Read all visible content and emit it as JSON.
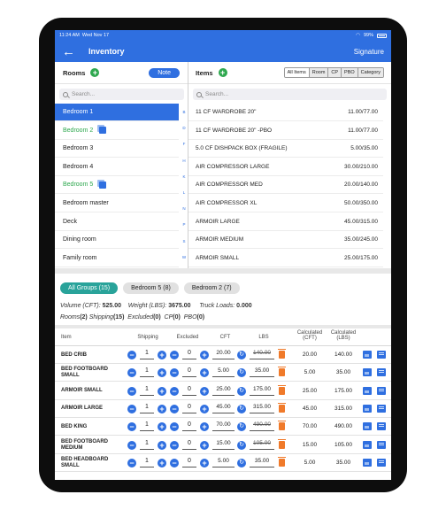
{
  "status": {
    "time": "11:24 AM",
    "date": "Wed Nov 17",
    "battery": "99%"
  },
  "nav": {
    "back_icon": "back-arrow-icon",
    "title": "Inventory",
    "signature": "Signature"
  },
  "rooms": {
    "header": "Rooms",
    "note_label": "Note",
    "search_placeholder": "Search...",
    "items": [
      {
        "label": "Bedroom 1",
        "state": "selected",
        "copy": false
      },
      {
        "label": "Bedroom 2",
        "state": "has-items",
        "copy": true
      },
      {
        "label": "Bedroom 3",
        "state": "normal",
        "copy": false
      },
      {
        "label": "Bedroom 4",
        "state": "normal",
        "copy": false
      },
      {
        "label": "Bedroom 5",
        "state": "has-items",
        "copy": true
      },
      {
        "label": "Bedroom master",
        "state": "normal",
        "copy": false
      },
      {
        "label": "Deck",
        "state": "normal",
        "copy": false
      },
      {
        "label": "Dining room",
        "state": "normal",
        "copy": false
      },
      {
        "label": "Family room",
        "state": "normal",
        "copy": false
      }
    ],
    "index_letters": [
      "B",
      "D",
      "F",
      "H",
      "K",
      "L",
      "N",
      "P",
      "S",
      "W"
    ]
  },
  "items": {
    "header": "Items",
    "search_placeholder": "Search...",
    "filters": [
      "All Items",
      "Room",
      "CP",
      "PBO",
      "Category"
    ],
    "list": [
      {
        "label": "11 CF WARDROBE 20\"",
        "value": "11.00/77.00"
      },
      {
        "label": "11 CF WARDROBE 20\" -PBO",
        "value": "11.00/77.00"
      },
      {
        "label": "5.0 CF DISHPACK BOX (FRAGILE)",
        "value": "5.00/35.00"
      },
      {
        "label": "AIR COMPRESSOR LARGE",
        "value": "30.00/210.00"
      },
      {
        "label": "AIR COMPRESSOR MED",
        "value": "20.00/140.00"
      },
      {
        "label": "AIR COMPRESSOR XL",
        "value": "50.00/350.00"
      },
      {
        "label": "ARMOIR LARGE",
        "value": "45.00/315.00"
      },
      {
        "label": "ARMOIR MEDIUM",
        "value": "35.00/245.00"
      },
      {
        "label": "ARMOIR SMALL",
        "value": "25.00/175.00"
      }
    ]
  },
  "groups": {
    "chips": [
      "All Groups (15)",
      "Bedroom 5 (8)",
      "Bedroom 2 (7)"
    ]
  },
  "summary": {
    "volume_label": "Volume (CFT):",
    "volume_value": "525.00",
    "weight_label": "Weight (LBS):",
    "weight_value": "3675.00",
    "truck_label": "Truck Loads:",
    "truck_value": "0.000",
    "rooms_label": "Rooms",
    "rooms_value": "(2)",
    "shipping_label": "Shipping",
    "shipping_value": "(15)",
    "excluded_label": "Excluded",
    "excluded_value": "(0)",
    "cp_label": "CP",
    "cp_value": "(0)",
    "pbo_label": "PBO",
    "pbo_value": "(0)"
  },
  "table": {
    "headers": {
      "item": "Item",
      "shipping": "Shipping",
      "excluded": "Excluded",
      "cft": "CFT",
      "lbs": "LBS",
      "calc_cft_1": "Calculated",
      "calc_cft_2": "(CFT)",
      "calc_lbs_1": "Calculated",
      "calc_lbs_2": "(LBS)"
    },
    "rows": [
      {
        "name": "BED CRIB",
        "shipping": "1",
        "excluded": "0",
        "cft": "20.00",
        "lbs": "140.00",
        "lbs_struck": true,
        "calc_cft": "20.00",
        "calc_lbs": "140.00"
      },
      {
        "name": "BED FOOTBOARD SMALL",
        "shipping": "1",
        "excluded": "0",
        "cft": "5.00",
        "lbs": "35.00",
        "lbs_struck": false,
        "calc_cft": "5.00",
        "calc_lbs": "35.00"
      },
      {
        "name": "ARMOIR SMALL",
        "shipping": "1",
        "excluded": "0",
        "cft": "25.00",
        "lbs": "175.00",
        "lbs_struck": false,
        "calc_cft": "25.00",
        "calc_lbs": "175.00"
      },
      {
        "name": "ARMOIR LARGE",
        "shipping": "1",
        "excluded": "0",
        "cft": "45.00",
        "lbs": "315.00",
        "lbs_struck": false,
        "calc_cft": "45.00",
        "calc_lbs": "315.00"
      },
      {
        "name": "BED KING",
        "shipping": "1",
        "excluded": "0",
        "cft": "70.00",
        "lbs": "490.00",
        "lbs_struck": true,
        "calc_cft": "70.00",
        "calc_lbs": "490.00"
      },
      {
        "name": "BED FOOTBOARD MEDIUM",
        "shipping": "1",
        "excluded": "0",
        "cft": "15.00",
        "lbs": "105.00",
        "lbs_struck": true,
        "calc_cft": "15.00",
        "calc_lbs": "105.00"
      },
      {
        "name": "BED HEADBOARD SMALL",
        "shipping": "1",
        "excluded": "0",
        "cft": "5.00",
        "lbs": "35.00",
        "lbs_struck": false,
        "calc_cft": "5.00",
        "calc_lbs": "35.00"
      }
    ],
    "minus_symbol": "−",
    "plus_symbol": "+",
    "cycle_symbol": "↻"
  },
  "colors": {
    "primary": "#2f6fe0",
    "green": "#2fa84f",
    "teal": "#29a39a",
    "orange": "#f07a2a"
  }
}
